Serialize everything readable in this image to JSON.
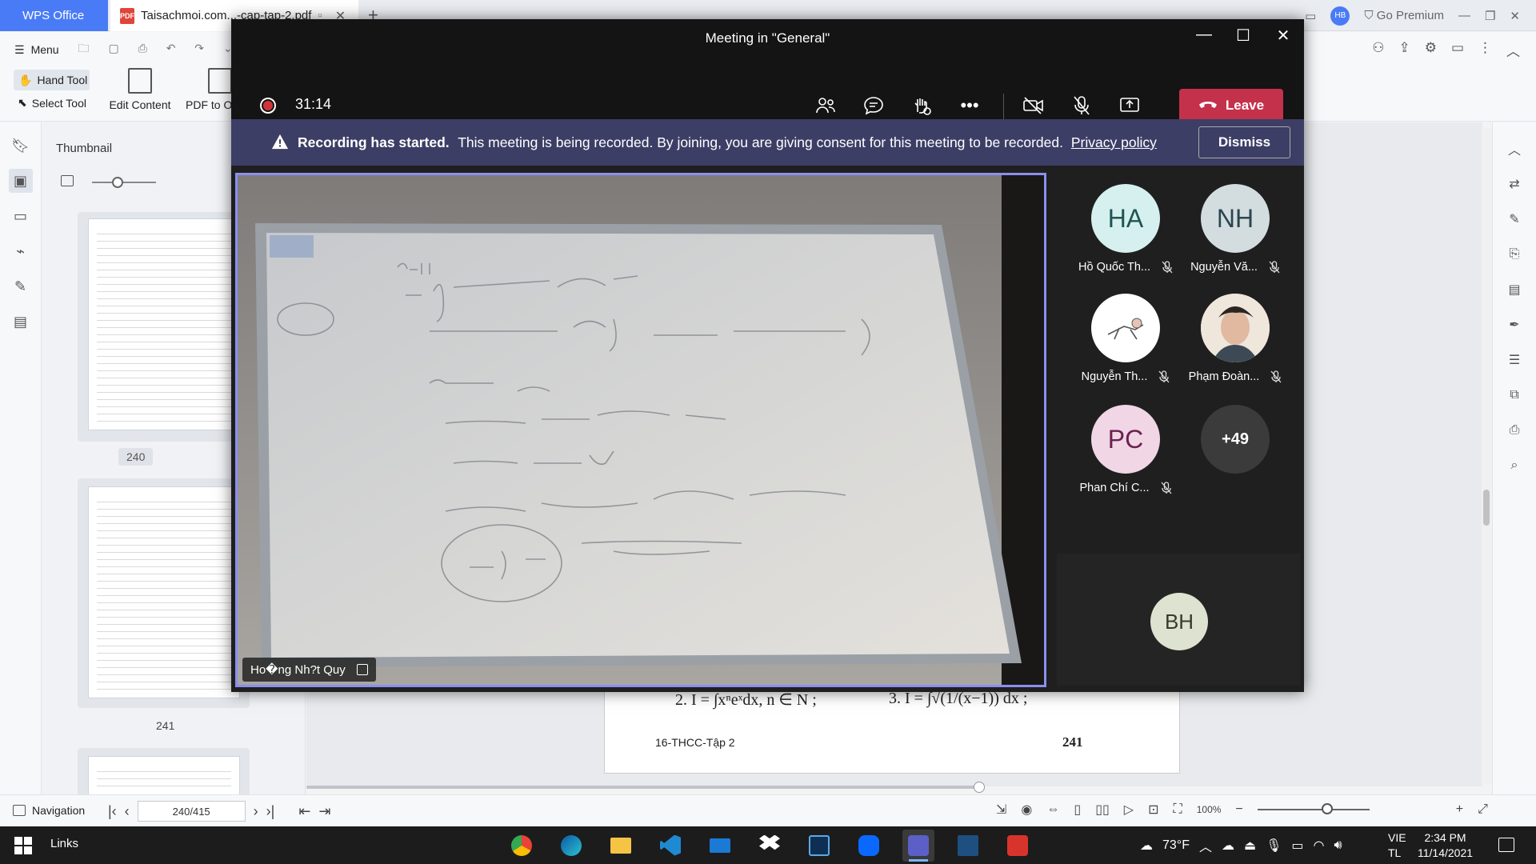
{
  "wps": {
    "home_tab": "WPS Office",
    "doc_tab": "Taisachmoi.com...-cap-tap-2.pdf",
    "go_premium": "Go Premium",
    "user_initials": "HB",
    "toolbar": {
      "menu": "Menu",
      "hand_tool": "Hand Tool",
      "select_tool": "Select Tool",
      "edit_content": "Edit Content",
      "pdf_to_office": "PDF to Of"
    },
    "thumbnail": {
      "title": "Thumbnail",
      "pages": [
        "240",
        "241"
      ]
    },
    "document": {
      "line1": "2.  I  = ∫xⁿeˣdx, n ∈ N ;",
      "line2": "3.  I = ∫√(1/(x−1)) dx ;",
      "footer_left": "16-THCC-Tập 2",
      "footer_right": "241"
    },
    "status": {
      "navigation": "Navigation",
      "page_indicator": "240/415",
      "zoom": "100%"
    }
  },
  "teams": {
    "title": "Meeting in \"General\"",
    "timer": "31:14",
    "leave": "Leave",
    "banner": {
      "bold": "Recording has started.",
      "text": "This meeting is being recorded. By joining, you are giving consent for this meeting to be recorded.",
      "link": "Privacy policy",
      "dismiss": "Dismiss"
    },
    "main_video": {
      "presenter": "Ho�ng Nh?t Quy"
    },
    "participants": [
      {
        "initials": "HA",
        "name": "Hồ Quốc Th...",
        "bg": "#d5f0ef",
        "fg": "#1e5553"
      },
      {
        "initials": "NH",
        "name": "Nguyễn Vă...",
        "bg": "#d3dde0",
        "fg": "#2b4650"
      },
      {
        "initials": "",
        "name": "Nguyễn Th...",
        "bg": "#ffffff",
        "fg": "#333333"
      },
      {
        "initials": "",
        "name": "Phạm Đoàn...",
        "bg": "#e8ddd3",
        "fg": "#333333"
      },
      {
        "initials": "PC",
        "name": "Phan Chí C...",
        "bg": "#f1d6e6",
        "fg": "#6b2150"
      },
      {
        "initials": "+49",
        "name": "",
        "bg": "#3b3b3b",
        "fg": "#ffffff"
      }
    ],
    "spotlight_initials": "BH"
  },
  "taskbar": {
    "links": "Links",
    "weather": "73°F",
    "lang_top": "VIE",
    "lang_bottom": "TL",
    "time": "2:34 PM",
    "date": "11/14/2021"
  },
  "colors": {
    "teams_bg": "#1f1f1f",
    "leave_red": "#c4314b",
    "banner_bg": "#3d3e66",
    "tile_border": "#8a8ff0",
    "wps_blue": "#4a7bf7"
  }
}
